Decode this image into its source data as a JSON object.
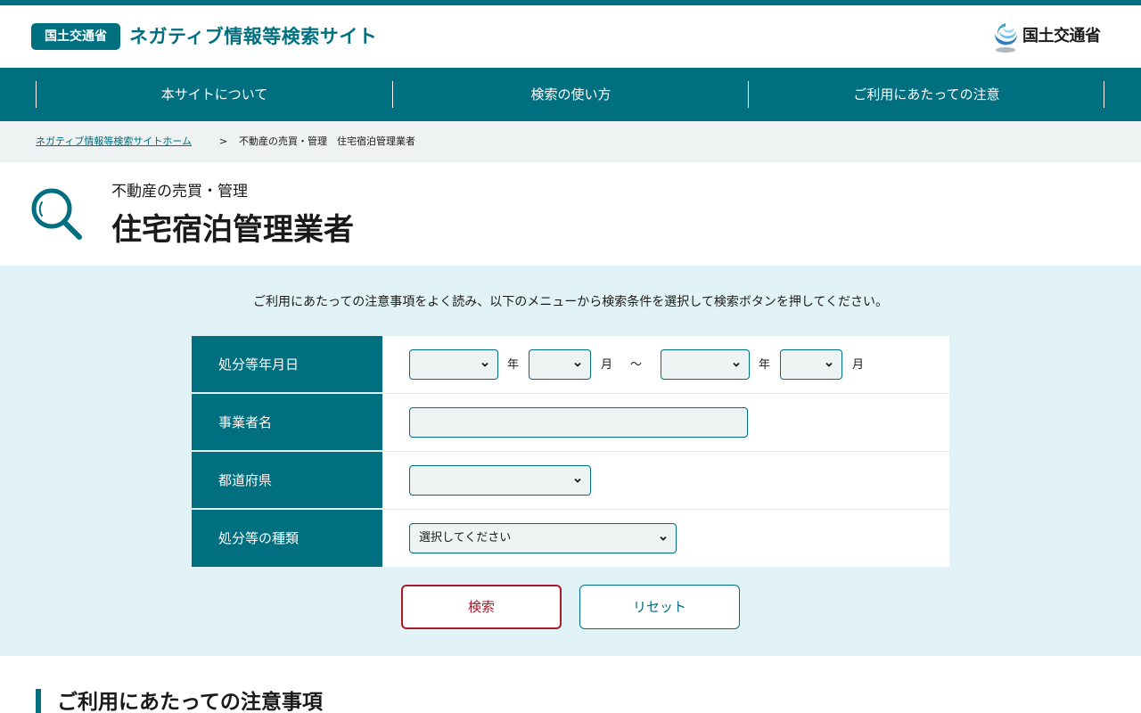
{
  "header": {
    "badge": "国土交通省",
    "site_title": "ネガティブ情報等検索サイト",
    "ministry_logo_text": "国土交通省",
    "ministry_logo_icon": "mlit-wave-icon"
  },
  "nav": {
    "items": [
      {
        "label": "本サイトについて"
      },
      {
        "label": "検索の使い方"
      },
      {
        "label": "ご利用にあたっての注意"
      }
    ]
  },
  "breadcrumb": {
    "home": "ネガティブ情報等検索サイトホーム",
    "separator": ">",
    "current": "不動産の売買・管理　住宅宿泊管理業者"
  },
  "page": {
    "category": "不動産の売買・管理",
    "title": "住宅宿泊管理業者",
    "icon": "search-icon"
  },
  "search": {
    "instruction": "ご利用にあたっての注意事項をよく読み、以下のメニューから検索条件を選択して検索ボタンを押してください。",
    "fields": {
      "date": {
        "label": "処分等年月日",
        "year_unit": "年",
        "month_unit": "月",
        "range_sep": "～",
        "from_year": "",
        "from_month": "",
        "to_year": "",
        "to_month": ""
      },
      "company": {
        "label": "事業者名",
        "value": "",
        "placeholder": ""
      },
      "prefecture": {
        "label": "都道府県",
        "value": ""
      },
      "type": {
        "label": "処分等の種類",
        "value": "選択してください"
      }
    },
    "buttons": {
      "search": "検索",
      "reset": "リセット"
    }
  },
  "notes": {
    "heading": "ご利用にあたっての注意事項"
  },
  "colors": {
    "primary": "#006f80",
    "search_accent": "#a8192b",
    "panel_bg": "#e2f3f7",
    "breadcrumb_bg": "#eef2f2"
  }
}
